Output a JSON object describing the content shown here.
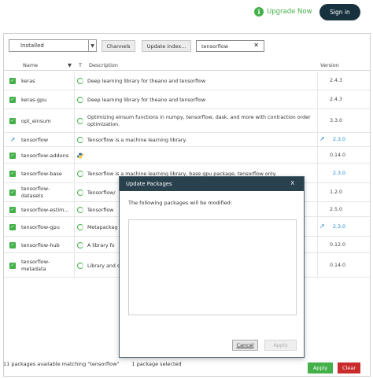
{
  "topbar": {
    "upgrade_label": "Upgrade Now",
    "signin_label": "Sign in"
  },
  "toolbar": {
    "filter_value": "Installed",
    "channels_label": "Channels",
    "update_index_label": "Update index...",
    "search_value": "tensorflow"
  },
  "columns": {
    "name": "Name",
    "t": "T",
    "description": "Description",
    "version": "Version"
  },
  "packages": [
    {
      "name": "keras",
      "description": "Deep learning library for theano and tensorflow",
      "version": "2.4.3",
      "state": "installed"
    },
    {
      "name": "keras-gpu",
      "description": "Deep learning library for theano and tensorflow",
      "version": "2.4.3",
      "state": "installed"
    },
    {
      "name": "opt_einsum",
      "description": "Optimizing einsum functions in numpy, tensorflow, dask, and more with contraction order optimization.",
      "version": "3.3.0",
      "state": "installed"
    },
    {
      "name": "tensorflow",
      "description": "Tensorflow is a machine learning library.",
      "version": "2.3.0",
      "state": "update"
    },
    {
      "name": "tensorflow-addons",
      "description": "",
      "version": "0.14.0",
      "state": "installed"
    },
    {
      "name": "tensorflow-base",
      "description": "Tensorflow is a machine learning library, base gpu package, tensorflow only.",
      "version": "2.3.0",
      "state": "installed"
    },
    {
      "name": "tensorflow-datasets",
      "description": "Tensorflow/",
      "version": "1.2.0",
      "state": "installed"
    },
    {
      "name": "tensorflow-estim...",
      "description": "Tensorflow",
      "version": "2.5.0",
      "state": "installed"
    },
    {
      "name": "tensorflow-gpu",
      "description": "Metapackag",
      "version": "2.3.0",
      "state": "installed"
    },
    {
      "name": "tensorflow-hub",
      "description": "A library fo",
      "version": "0.12.0",
      "state": "installed"
    },
    {
      "name": "tensorflow-metadata",
      "description": "Library and s",
      "version": "0.14.0",
      "state": "installed"
    }
  ],
  "status": {
    "matching": "11 packages available matching \"tensorflow\"",
    "selected": "1 package selected"
  },
  "footer": {
    "apply_label": "Apply",
    "clear_label": "Clear"
  },
  "modal": {
    "title": "Update Packages",
    "close_label": "X",
    "message": "The following packages will be modified:",
    "cancel_label": "Cancel",
    "apply_label": "Apply"
  },
  "colors": {
    "accent_green": "#43b049",
    "update_blue": "#1e88d3",
    "clear_red": "#c92b2b",
    "dark_navy": "#17313e"
  }
}
